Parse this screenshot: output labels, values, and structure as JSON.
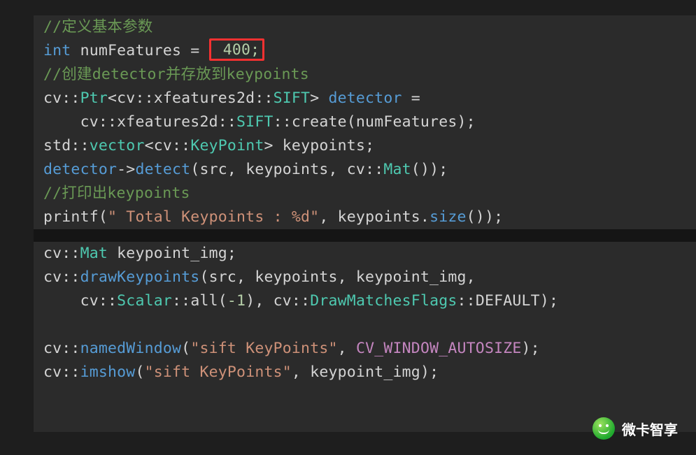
{
  "code": {
    "l1_comment": "//定义基本参数",
    "l2_kw": "int",
    "l2_var": " numFeatures = ",
    "l2_boxed": " 400;",
    "l3_comment": "//创建detector并存放到keypoints",
    "l4_a": "cv::",
    "l4_Ptr": "Ptr",
    "l4_b": "<cv::xfeatures2d::",
    "l4_SIFT1": "SIFT",
    "l4_c": "> ",
    "l4_detector": "detector",
    "l4_d": " =",
    "l5_pad": "    ",
    "l5_a": "cv::xfeatures2d::",
    "l5_SIFT": "SIFT",
    "l5_b": "::create(numFeatures);",
    "l6_a": "std::",
    "l6_vector": "vector",
    "l6_b": "<cv::",
    "l6_KeyPoint": "KeyPoint",
    "l6_c": "> keypoints;",
    "l7_detector": "detector",
    "l7_a": "->",
    "l7_detect": "detect",
    "l7_b": "(src, keypoints, cv::",
    "l7_Mat": "Mat",
    "l7_c": "());",
    "l8_comment": "//打印出keypoints",
    "l9_a": "printf(",
    "l9_str": "\" Total Keypoints : %d\"",
    "l9_b": ", keypoints.",
    "l9_size": "size",
    "l9_c": "());",
    "l10_a": "cv::",
    "l10_Mat": "Mat",
    "l10_b": " keypoint_img;",
    "l11_a": "cv::",
    "l11_draw": "drawKeypoints",
    "l11_b": "(src, keypoints, keypoint_img,",
    "l12_pad": "    ",
    "l12_a": "cv::",
    "l12_Scalar": "Scalar",
    "l12_b": "::all(",
    "l12_neg1": "-1",
    "l12_c": "), cv::",
    "l12_DMF": "DrawMatchesFlags",
    "l12_d": "::DEFAULT);",
    "l13_a": "cv::",
    "l13_nw": "namedWindow",
    "l13_b": "(",
    "l13_str": "\"sift KeyPoints\"",
    "l13_c": ", ",
    "l13_macro": "CV_WINDOW_AUTOSIZE",
    "l13_d": ");",
    "l14_a": "cv::",
    "l14_imshow": "imshow",
    "l14_b": "(",
    "l14_str": "\"sift KeyPoints\"",
    "l14_c": ", keypoint_img);"
  },
  "watermark": {
    "text": "微卡智享"
  },
  "annotation": {
    "boxed_value_semantic": "numFeatures-literal-highlight"
  }
}
